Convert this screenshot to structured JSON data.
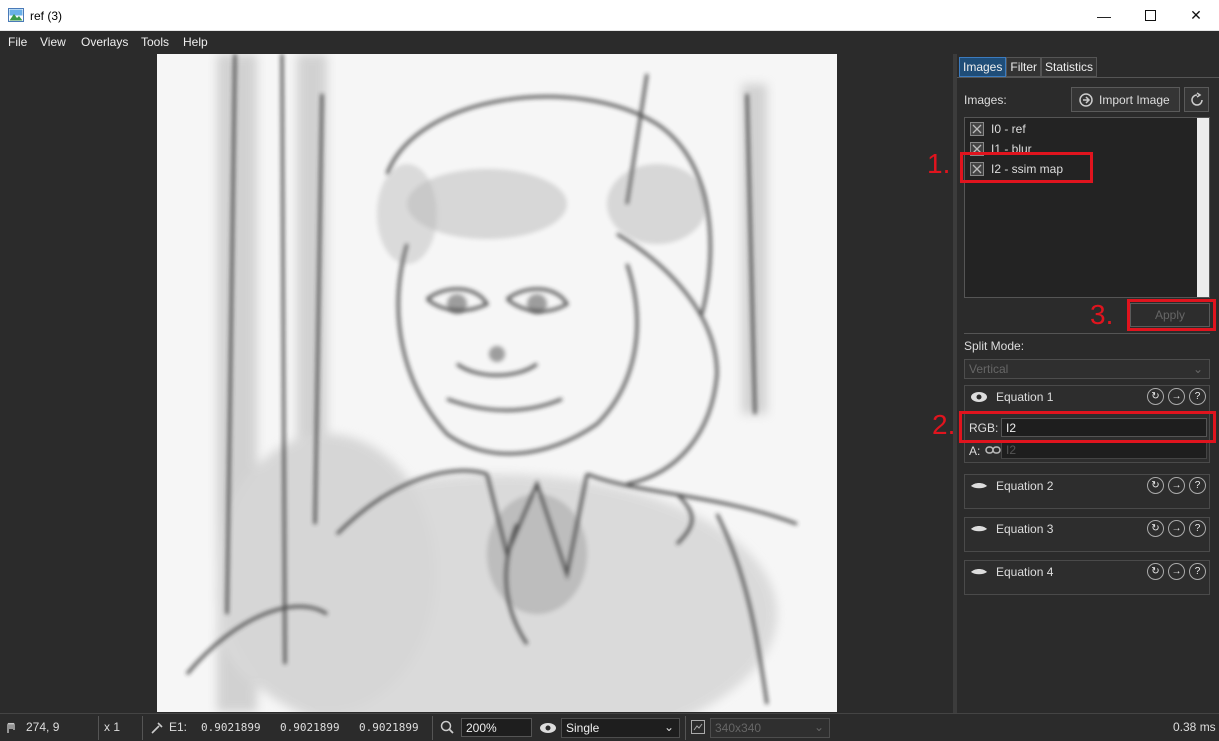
{
  "window": {
    "title": "ref (3)"
  },
  "menu": [
    "File",
    "View",
    "Overlays",
    "Tools",
    "Help"
  ],
  "tabs": [
    "Images",
    "Filter",
    "Statistics"
  ],
  "images_panel": {
    "label": "Images:",
    "import_button": "Import Image",
    "items": [
      "I0 - ref",
      "I1 - blur",
      "I2 - ssim map"
    ],
    "apply_button": "Apply"
  },
  "split": {
    "label": "Split Mode:",
    "value": "Vertical"
  },
  "equations": [
    {
      "title": "Equation 1",
      "rgb_label": "RGB:",
      "rgb_value": "I2",
      "a_label": "A:",
      "a_value": "I2"
    },
    {
      "title": "Equation 2"
    },
    {
      "title": "Equation 3"
    },
    {
      "title": "Equation 4"
    }
  ],
  "annotations": [
    "1.",
    "2.",
    "3."
  ],
  "status": {
    "cursor": "274, 9",
    "zoom_factor": "x 1",
    "eq_label": "E1:",
    "values": [
      "0.9021899",
      "0.9021899",
      "0.9021899"
    ],
    "zoom": "200%",
    "mode": "Single",
    "size": "340x340",
    "time": "0.38 ms"
  },
  "colors": {
    "accent": "#1f4d78",
    "highlight": "#e0141e",
    "background": "#2b2b2b"
  },
  "icons": [
    "app-icon",
    "minimize-icon",
    "maximize-icon",
    "close-icon",
    "import-icon",
    "refresh-icon",
    "image-item-icon",
    "eye-icon",
    "eye-closed-icon",
    "help-icon",
    "picker-icon",
    "zoom-icon",
    "link-icon",
    "image-size-icon",
    "cursor-icon"
  ]
}
